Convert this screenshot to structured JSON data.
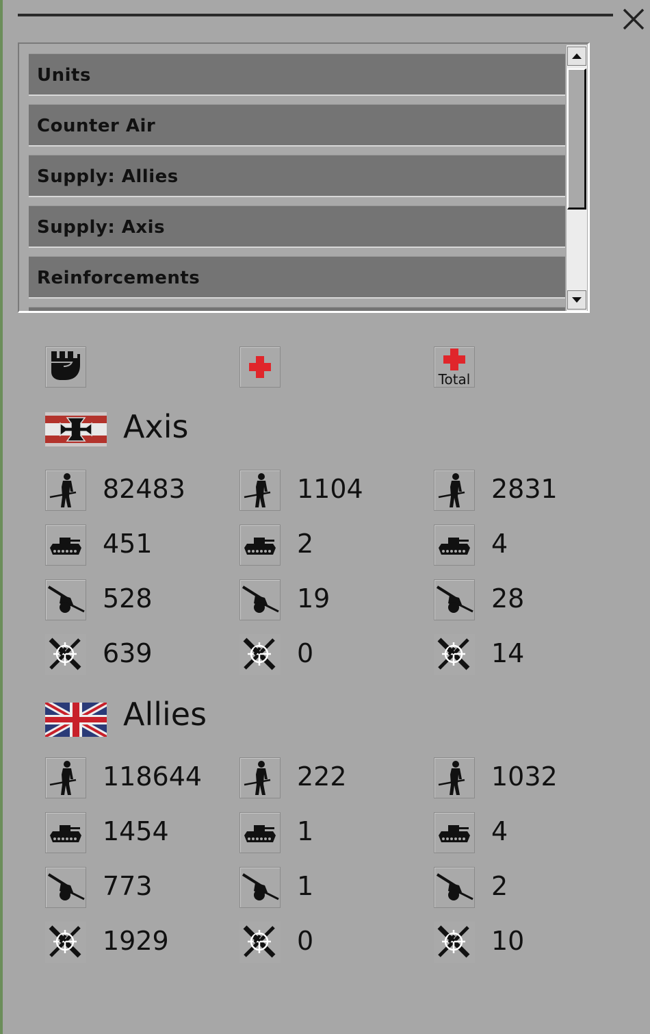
{
  "window": {
    "close_glyph": "×"
  },
  "list": {
    "items": [
      {
        "label": "Units"
      },
      {
        "label": "Counter Air"
      },
      {
        "label": "Supply: Allies"
      },
      {
        "label": "Supply: Axis"
      },
      {
        "label": "Reinforcements"
      }
    ]
  },
  "headers": {
    "strength_icon": "fist-icon",
    "losses_icon": "red-cross-icon",
    "total_losses_icon": "red-cross-total-icon",
    "total_label": "Total"
  },
  "sides": [
    {
      "name": "Axis",
      "flag": "german-iron-cross-flag",
      "rows": [
        {
          "icon": "infantry-icon",
          "values": [
            "82483",
            "1104",
            "2831"
          ]
        },
        {
          "icon": "tank-icon",
          "values": [
            "451",
            "2",
            "4"
          ]
        },
        {
          "icon": "artillery-icon",
          "values": [
            "528",
            "19",
            "28"
          ]
        },
        {
          "icon": "aircraft-icon",
          "values": [
            "639",
            "0",
            "14"
          ]
        }
      ]
    },
    {
      "name": "Allies",
      "flag": "union-jack-flag",
      "rows": [
        {
          "icon": "infantry-icon",
          "values": [
            "118644",
            "222",
            "1032"
          ]
        },
        {
          "icon": "tank-icon",
          "values": [
            "1454",
            "1",
            "4"
          ]
        },
        {
          "icon": "artillery-icon",
          "values": [
            "773",
            "1",
            "2"
          ]
        },
        {
          "icon": "aircraft-icon",
          "values": [
            "1929",
            "0",
            "10"
          ]
        }
      ]
    }
  ],
  "colors": {
    "panel": "#a7a7a7",
    "list_item": "#747474",
    "red_cross": "#e0262b"
  }
}
